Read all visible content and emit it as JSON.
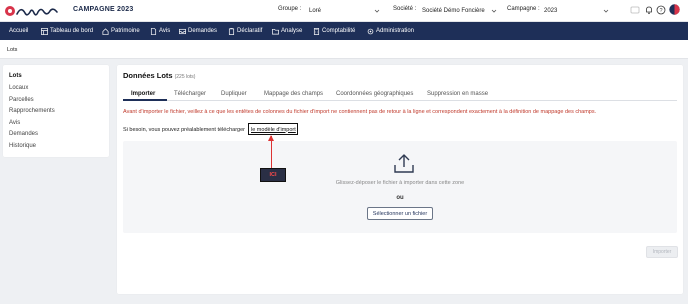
{
  "header": {
    "campaign_title": "CAMPAGNE 2023",
    "groupe_label": "Groupe :",
    "groupe_value": "Loré",
    "societe_label": "Société :",
    "societe_value": "Société Démo Foncière",
    "campagne_label": "Campagne :",
    "campagne_value": "2023",
    "icons": [
      "search-icon",
      "bell-icon",
      "help-icon",
      "user-avatar"
    ]
  },
  "nav": {
    "items": [
      {
        "label": "Accueil",
        "icon": ""
      },
      {
        "label": "Tableau de bord",
        "icon": "dashboard-icon"
      },
      {
        "label": "Patrimoine",
        "icon": "home-icon"
      },
      {
        "label": "Avis",
        "icon": "document-icon"
      },
      {
        "label": "Demandes",
        "icon": "inbox-icon"
      },
      {
        "label": "Déclaratif",
        "icon": "clipboard-icon"
      },
      {
        "label": "Analyse",
        "icon": "folder-icon"
      },
      {
        "label": "Comptabilité",
        "icon": "calculator-icon"
      },
      {
        "label": "Administration",
        "icon": "gear-icon"
      }
    ]
  },
  "breadcrumb": "Lots",
  "sidebar": {
    "items": [
      {
        "label": "Lots",
        "active": true
      },
      {
        "label": "Locaux",
        "active": false
      },
      {
        "label": "Parcelles",
        "active": false
      },
      {
        "label": "Rapprochements",
        "active": false
      },
      {
        "label": "Avis",
        "active": false
      },
      {
        "label": "Demandes",
        "active": false
      },
      {
        "label": "Historique",
        "active": false
      }
    ]
  },
  "main": {
    "title": "Données Lots",
    "count": "(225 lots)",
    "tabs": [
      {
        "label": "Importer",
        "active": true
      },
      {
        "label": "Télécharger",
        "active": false
      },
      {
        "label": "Dupliquer",
        "active": false
      },
      {
        "label": "Mappage des champs",
        "active": false
      },
      {
        "label": "Coordonnées géographiques",
        "active": false
      },
      {
        "label": "Suppression en masse",
        "active": false
      }
    ],
    "warning": "Avant d'importer le fichier, veillez à ce que les entêtes de colonnes du fichier d'import ne contiennent pas de retour à la ligne et correspondent exactement à la définition de mappage des champs.",
    "template_prefix": "Si besoin, vous pouvez préalablement télécharger",
    "template_link": "le modèle d'import",
    "annotation": "ICI",
    "drop_hint": "Glissez-déposer le fichier à importer dans cette zone",
    "drop_or": "ou",
    "select_file_label": "Sélectionner un fichier",
    "import_label": "Importer"
  },
  "colors": {
    "navbar": "#1e2f58",
    "warning": "#c0392b",
    "annotation_text": "#ff4a4a",
    "annotation_arrow": "#dd3333"
  }
}
